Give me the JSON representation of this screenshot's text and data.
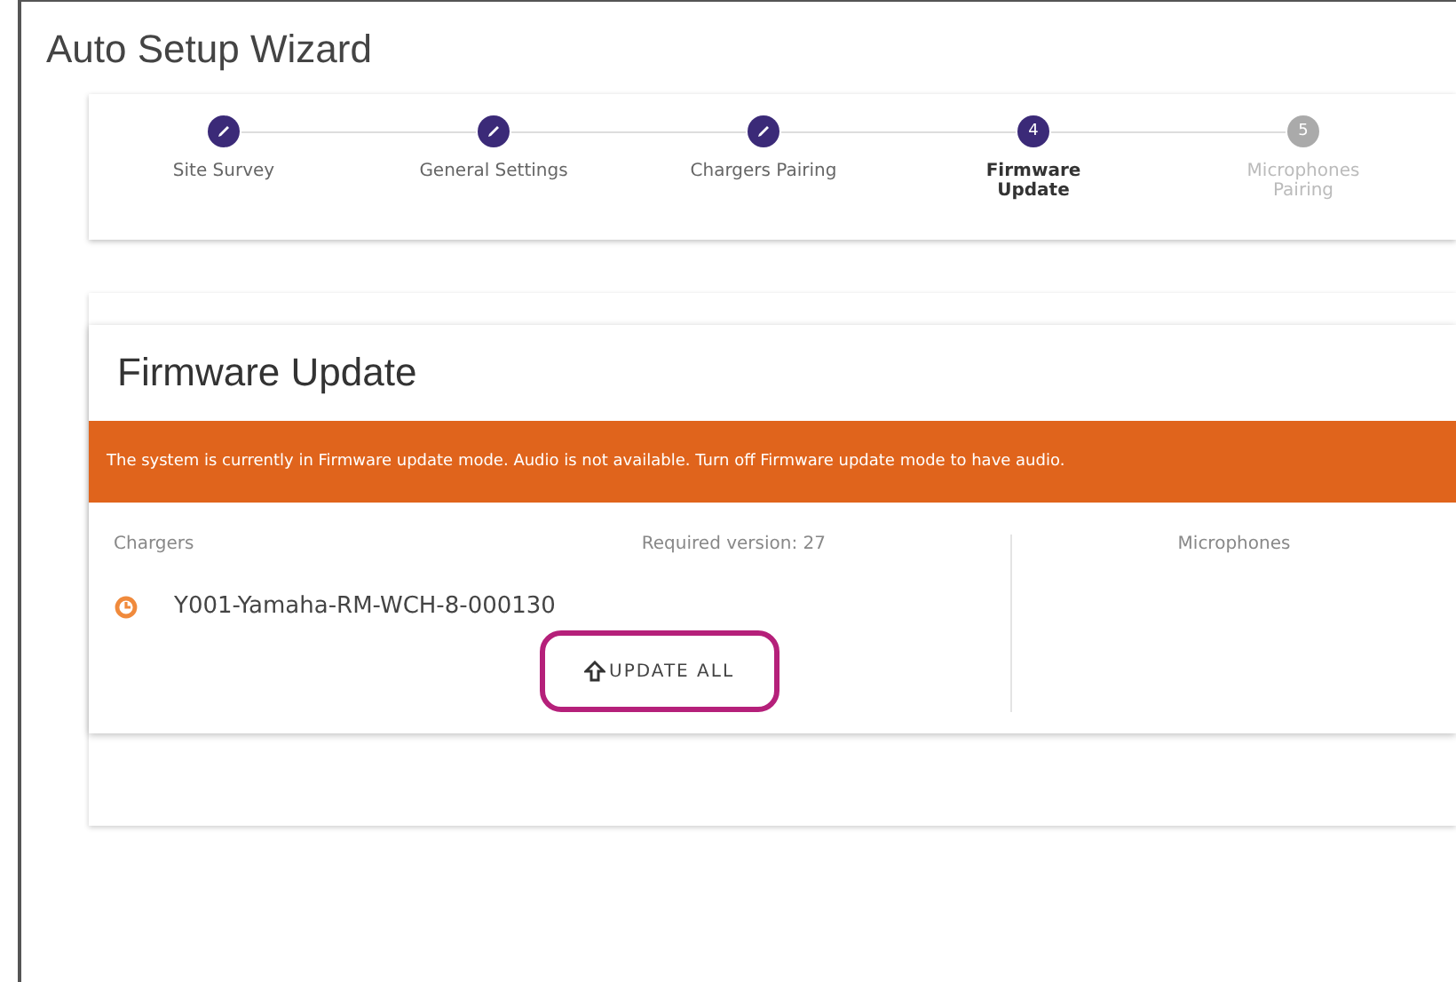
{
  "window": {
    "title": "Auto Setup Wizard"
  },
  "steps": [
    {
      "label": "Site Survey",
      "completed": true,
      "selected": false
    },
    {
      "label": "General Settings",
      "completed": true,
      "selected": false
    },
    {
      "label": "Chargers Pairing",
      "completed": true,
      "selected": false
    },
    {
      "label": "Firmware Update",
      "completed": false,
      "selected": true,
      "number": "4"
    },
    {
      "label": "Microphones Pairing",
      "completed": false,
      "selected": false,
      "number": "5"
    }
  ],
  "panel": {
    "title": "Firmware Update",
    "banner": "The system is currently in Firmware update mode. Audio is not available. Turn off Firmware update mode to have audio.",
    "chargers": {
      "heading": "Chargers",
      "required": "Required version: 27",
      "devices": [
        {
          "name": "Y001-Yamaha-RM-WCH-8-000130",
          "pending": true
        }
      ],
      "button": {
        "label": "UPDATE ALL",
        "highlighted": true
      }
    },
    "microphones": {
      "heading": "Microphones"
    }
  }
}
